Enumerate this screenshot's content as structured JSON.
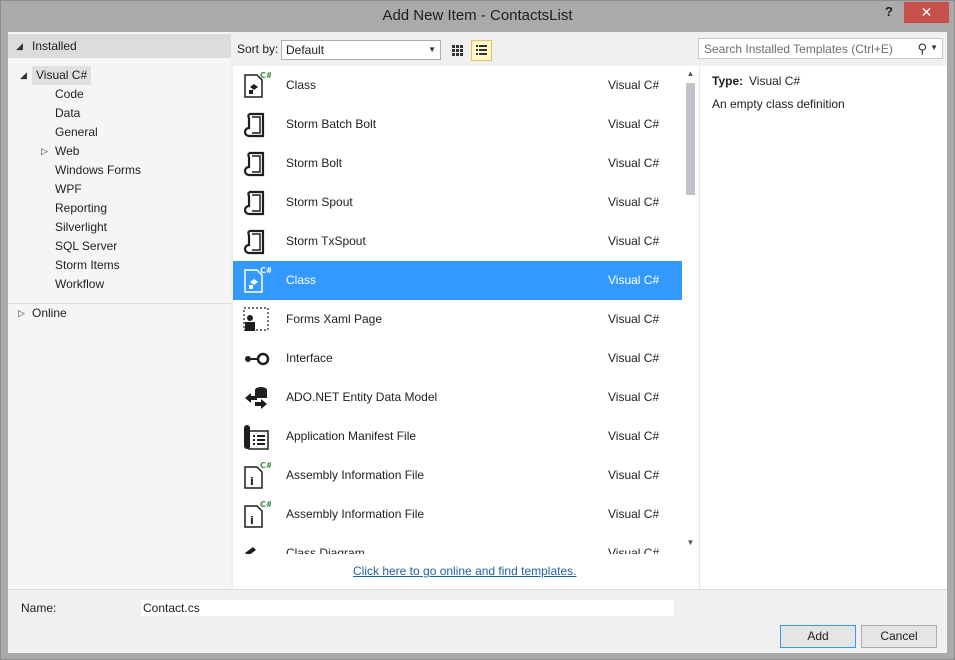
{
  "window": {
    "title": "Add New Item - ContactsList",
    "help_label": "?",
    "close_label": "✕"
  },
  "tree": {
    "installed": "Installed",
    "visual_csharp": "Visual C#",
    "children": [
      "Code",
      "Data",
      "General",
      "Web",
      "Windows Forms",
      "WPF",
      "Reporting",
      "Silverlight",
      "SQL Server",
      "Storm Items",
      "Workflow"
    ],
    "online": "Online"
  },
  "toolbar": {
    "sort_label": "Sort by:",
    "sort_value": "Default",
    "search_placeholder": "Search Installed Templates (Ctrl+E)"
  },
  "templates": [
    {
      "name": "Class",
      "lang": "Visual C#",
      "icon": "class-icon"
    },
    {
      "name": "Storm Batch Bolt",
      "lang": "Visual C#",
      "icon": "storm-icon"
    },
    {
      "name": "Storm Bolt",
      "lang": "Visual C#",
      "icon": "storm-icon"
    },
    {
      "name": "Storm Spout",
      "lang": "Visual C#",
      "icon": "storm-icon"
    },
    {
      "name": "Storm TxSpout",
      "lang": "Visual C#",
      "icon": "storm-icon"
    },
    {
      "name": "Class",
      "lang": "Visual C#",
      "icon": "class-icon",
      "selected": true
    },
    {
      "name": "Forms Xaml Page",
      "lang": "Visual C#",
      "icon": "xaml-page-icon"
    },
    {
      "name": "Interface",
      "lang": "Visual C#",
      "icon": "interface-icon"
    },
    {
      "name": "ADO.NET Entity Data Model",
      "lang": "Visual C#",
      "icon": "entity-model-icon"
    },
    {
      "name": "Application Manifest File",
      "lang": "Visual C#",
      "icon": "manifest-icon"
    },
    {
      "name": "Assembly Information File",
      "lang": "Visual C#",
      "icon": "assembly-info-icon"
    },
    {
      "name": "Assembly Information File",
      "lang": "Visual C#",
      "icon": "assembly-info-icon"
    },
    {
      "name": "Class Diagram",
      "lang": "Visual C#",
      "icon": "class-diagram-icon"
    }
  ],
  "online_link": "Click here to go online and find templates.",
  "details": {
    "type_label": "Type:",
    "type_value": "Visual C#",
    "description": "An empty class definition"
  },
  "form": {
    "name_label": "Name:",
    "name_value": "Contact.cs",
    "add_label": "Add",
    "cancel_label": "Cancel"
  },
  "colors": {
    "selection": "#3399ff",
    "close_button": "#c7504a",
    "link": "#1f5fa8",
    "csharp_badge": "#3c8a3c"
  }
}
